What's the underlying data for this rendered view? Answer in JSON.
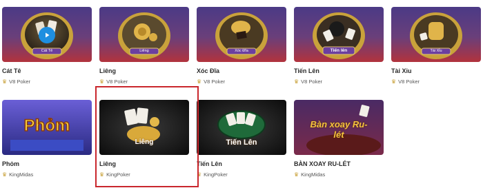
{
  "games": [
    {
      "title": "Cát Tê",
      "badge": "Cát Tê",
      "provider": "V8 Poker",
      "provider_icon": "crown-icon"
    },
    {
      "title": "Liêng",
      "badge": "Liêng",
      "provider": "V8 Poker",
      "provider_icon": "crown-icon"
    },
    {
      "title": "Xóc Đĩa",
      "badge": "Xóc Đĩa",
      "provider": "V8 Poker",
      "provider_icon": "crown-icon"
    },
    {
      "title": "Tiến Lên",
      "badge": "Tiến lên",
      "provider": "V8 Poker",
      "provider_icon": "crown-icon"
    },
    {
      "title": "Tài Xỉu",
      "badge": "Tài Xỉu",
      "provider": "V8 Poker",
      "provider_icon": "crown-icon"
    },
    {
      "title": "Phỏm",
      "badge": "Phỏm",
      "provider": "KingMidas",
      "provider_icon": "crown-icon"
    },
    {
      "title": "Liêng",
      "badge": "Liêng",
      "provider": "KingPoker",
      "provider_icon": "crown-icon"
    },
    {
      "title": "Tiến Lên",
      "badge": "Tiến Lên",
      "provider": "KingPoker",
      "provider_icon": "crown-icon"
    },
    {
      "title": "BÀN XOAY RU-LÉT",
      "badge": "Bàn xoay Ru-lét",
      "provider": "KingMidas",
      "provider_icon": "crown-icon"
    }
  ],
  "colors": {
    "selected_border": "#c9262c",
    "gold": "#d8b04a",
    "purple": "#3a2a6e"
  }
}
